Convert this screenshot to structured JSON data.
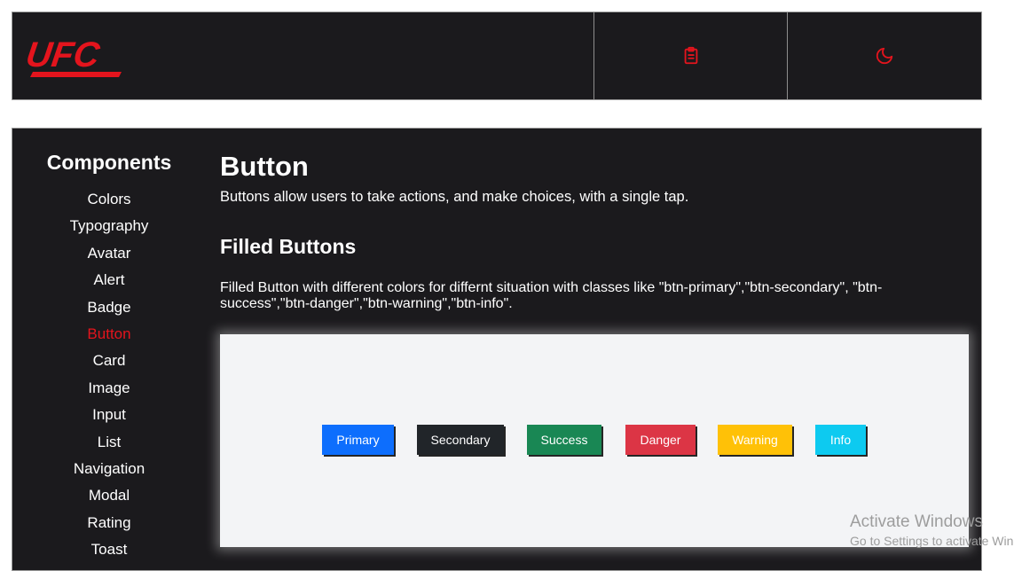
{
  "header": {
    "logo_text": "UFC",
    "brand_color": "#e4141d",
    "actions": [
      {
        "icon": "clipboard-icon"
      },
      {
        "icon": "moon-icon"
      }
    ]
  },
  "sidebar": {
    "title": "Components",
    "items": [
      {
        "label": "Colors"
      },
      {
        "label": "Typography"
      },
      {
        "label": "Avatar"
      },
      {
        "label": "Alert"
      },
      {
        "label": "Badge"
      },
      {
        "label": "Button",
        "active": true
      },
      {
        "label": "Card"
      },
      {
        "label": "Image"
      },
      {
        "label": "Input"
      },
      {
        "label": "List"
      },
      {
        "label": "Navigation"
      },
      {
        "label": "Modal"
      },
      {
        "label": "Rating"
      },
      {
        "label": "Toast"
      }
    ]
  },
  "content": {
    "title": "Button",
    "description": "Buttons allow users to take actions, and make choices, with a single tap.",
    "section_title": "Filled Buttons",
    "section_description": "Filled Button with different colors for differnt situation with classes like \"btn-primary\",\"btn-secondary\", \"btn-success\",\"btn-danger\",\"btn-warning\",\"btn-info\".",
    "buttons": [
      {
        "label": "Primary",
        "color": "#0d6efd"
      },
      {
        "label": "Secondary",
        "color": "#212529"
      },
      {
        "label": "Success",
        "color": "#198754"
      },
      {
        "label": "Danger",
        "color": "#dc3545"
      },
      {
        "label": "Warning",
        "color": "#ffc107"
      },
      {
        "label": "Info",
        "color": "#0dcaf0"
      }
    ]
  },
  "watermark": {
    "title": "Activate Windows",
    "subtitle": "Go to Settings to activate Windows."
  }
}
